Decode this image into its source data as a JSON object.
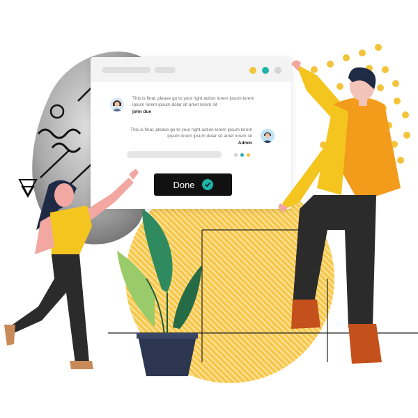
{
  "chat": {
    "messages": [
      {
        "text": "This is final. please go to your right action lorem ipsum lorem ipsum lorem ipsum dolar sit amet lorem sit",
        "author": "john due"
      },
      {
        "text": "This is final. please go to your right action lorem ipsum lorem ipsum lorem ipsum dolar sit amet lorem sit",
        "author": "Admin"
      }
    ],
    "done_label": "Done"
  },
  "colors": {
    "accent_teal": "#1fb3a8",
    "accent_yellow": "#f3c33b",
    "button_dark": "#111111",
    "shirt_yellow": "#f5c51f",
    "shirt_orange": "#f39b1b"
  },
  "icons": {
    "done": "check-circle-icon"
  }
}
